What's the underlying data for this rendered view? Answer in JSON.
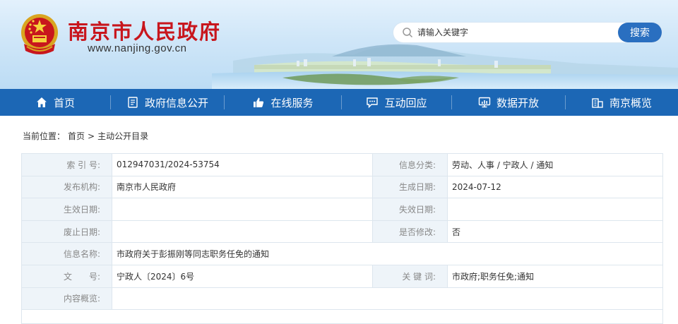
{
  "header": {
    "site_title": "南京市人民政府",
    "site_url": "www.nanjing.gov.cn",
    "search": {
      "placeholder": "请输入关键字",
      "button_label": "搜索"
    }
  },
  "nav": {
    "items": [
      {
        "label": "首页",
        "icon": "home-icon"
      },
      {
        "label": "政府信息公开",
        "icon": "document-icon"
      },
      {
        "label": "在线服务",
        "icon": "thumbs-up-icon"
      },
      {
        "label": "互动回应",
        "icon": "chat-icon"
      },
      {
        "label": "数据开放",
        "icon": "monitor-chart-icon"
      },
      {
        "label": "南京概览",
        "icon": "building-icon"
      }
    ]
  },
  "breadcrumb": {
    "prefix": "当前位置：",
    "home": "首页",
    "separator": ">",
    "current": "主动公开目录"
  },
  "info": {
    "index_label": "索 引 号:",
    "index_value": "012947031/2024-53754",
    "category_label": "信息分类:",
    "category_value": "劳动、人事 / 宁政人 / 通知",
    "publisher_label": "发布机构:",
    "publisher_value": "南京市人民政府",
    "created_label": "生成日期:",
    "created_value": "2024-07-12",
    "effective_label": "生效日期:",
    "effective_value": "",
    "expiry_label": "失效日期:",
    "expiry_value": "",
    "repeal_label": "废止日期:",
    "repeal_value": "",
    "modified_label": "是否修改:",
    "modified_value": "否",
    "name_label": "信息名称:",
    "name_value": "市政府关于彭振刚等同志职务任免的通知",
    "docno_label": "文　　号:",
    "docno_value": "宁政人〔2024〕6号",
    "keywords_label": "关 键 词:",
    "keywords_value": "市政府;职务任免;通知",
    "summary_label": "内容概览:",
    "summary_value": ""
  }
}
